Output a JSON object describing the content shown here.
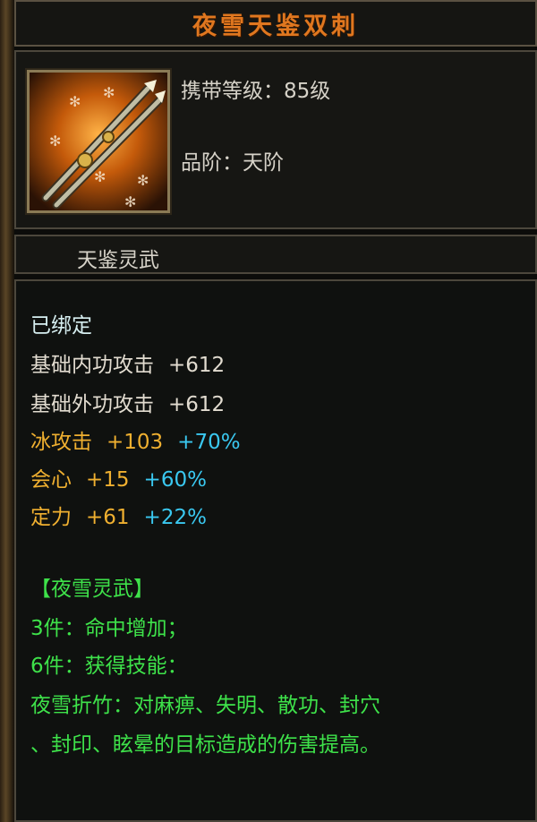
{
  "item": {
    "name": "夜雪天鉴双刺",
    "level_label": "携带等级：85级",
    "grade_label": "品阶：天阶",
    "category": "天鉴灵武",
    "icon": "twin-dagger-icon"
  },
  "stats": {
    "bound": "已绑定",
    "inner_attack": {
      "label": "基础内功攻击",
      "value": "+612"
    },
    "outer_attack": {
      "label": "基础外功攻击",
      "value": "+612"
    },
    "ice_attack": {
      "label": "冰攻击",
      "value": "+103",
      "bonus": "+70%"
    },
    "crit": {
      "label": "会心",
      "value": "+15",
      "bonus": "+60%"
    },
    "stability": {
      "label": "定力",
      "value": "+61",
      "bonus": "+22%"
    }
  },
  "set": {
    "name": "【夜雪灵武】",
    "effect3": "3件：命中增加；",
    "effect6": "6件：获得技能：",
    "skill_line1": "夜雪折竹：对麻痹、失明、散功、封穴",
    "skill_line2": "、封印、眩晕的目标造成的伤害提高。"
  },
  "colors": {
    "title": "#e0771f",
    "gold": "#f0b030",
    "cyan": "#3ac8f0",
    "green": "#3ee24a"
  }
}
